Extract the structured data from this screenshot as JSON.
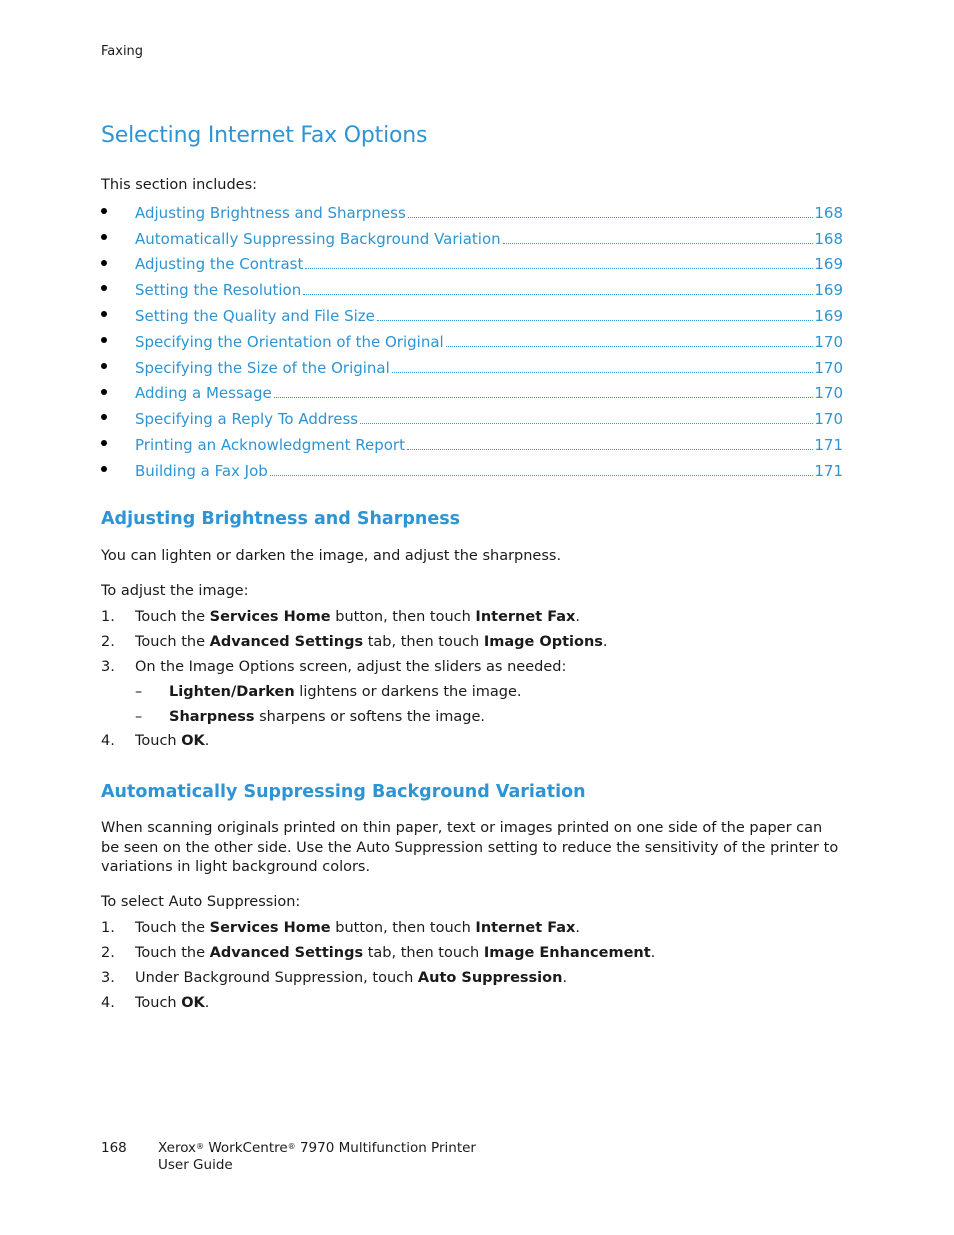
{
  "header": {
    "running_title": "Faxing"
  },
  "page_title": "Selecting Internet Fax Options",
  "intro": "This section includes:",
  "toc": [
    {
      "label": "Adjusting Brightness and Sharpness",
      "page": "168"
    },
    {
      "label": "Automatically Suppressing Background Variation",
      "page": "168"
    },
    {
      "label": "Adjusting the Contrast",
      "page": "169"
    },
    {
      "label": "Setting the Resolution",
      "page": "169"
    },
    {
      "label": "Setting the Quality and File Size",
      "page": "169"
    },
    {
      "label": "Specifying the Orientation of the Original",
      "page": "170"
    },
    {
      "label": "Specifying the Size of the Original",
      "page": "170"
    },
    {
      "label": "Adding a Message",
      "page": "170"
    },
    {
      "label": "Specifying a Reply To Address",
      "page": "170"
    },
    {
      "label": "Printing an Acknowledgment Report",
      "page": "171"
    },
    {
      "label": "Building a Fax Job",
      "page": "171"
    }
  ],
  "section1": {
    "heading": "Adjusting Brightness and Sharpness",
    "para": "You can lighten or darken the image, and adjust the sharpness.",
    "lead": "To adjust the image:",
    "steps": [
      {
        "num": "1.",
        "a": "Touch the ",
        "b1": "Services Home",
        "c": " button, then touch ",
        "b2": "Internet Fax",
        "d": "."
      },
      {
        "num": "2.",
        "a": "Touch the ",
        "b1": "Advanced Settings",
        "c": " tab, then touch ",
        "b2": "Image Options",
        "d": "."
      },
      {
        "num": "3.",
        "a": "On the Image Options screen, adjust the sliders as needed:"
      },
      {
        "dash": "–",
        "b1": "Lighten/Darken",
        "c": " lightens or darkens the image."
      },
      {
        "dash": "–",
        "b1": "Sharpness",
        "c": " sharpens or softens the image."
      },
      {
        "num": "4.",
        "a": "Touch ",
        "b1": "OK",
        "c": "."
      }
    ]
  },
  "section2": {
    "heading": "Automatically Suppressing Background Variation",
    "para": "When scanning originals printed on thin paper, text or images printed on one side of the paper can be seen on the other side. Use the Auto Suppression setting to reduce the sensitivity of the printer to variations in light background colors.",
    "lead": "To select Auto Suppression:",
    "steps": [
      {
        "num": "1.",
        "a": "Touch the ",
        "b1": "Services Home",
        "c": " button, then touch ",
        "b2": "Internet Fax",
        "d": "."
      },
      {
        "num": "2.",
        "a": "Touch the ",
        "b1": "Advanced Settings",
        "c": " tab, then touch ",
        "b2": "Image Enhancement",
        "d": "."
      },
      {
        "num": "3.",
        "a": "Under Background Suppression, touch ",
        "b1": "Auto Suppression",
        "c": "."
      },
      {
        "num": "4.",
        "a": "Touch ",
        "b1": "OK",
        "c": "."
      }
    ]
  },
  "footer": {
    "page_number": "168",
    "brand": "Xerox",
    "reg": "®",
    "product": "WorkCentre",
    "model": "7970 Multifunction Printer",
    "doc": "User Guide"
  }
}
